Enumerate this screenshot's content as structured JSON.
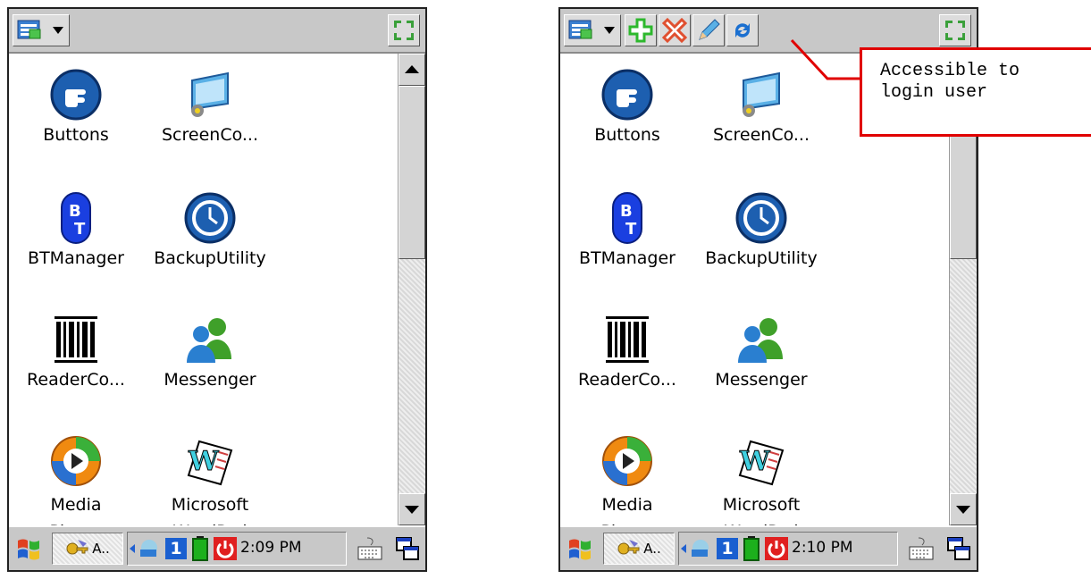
{
  "apps": [
    {
      "label": "Buttons",
      "icon": "pointing-hand-icon"
    },
    {
      "label": "ScreenCo...",
      "icon": "monitor-icon"
    },
    {
      "label": "BTManager",
      "icon": "bluetooth-icon"
    },
    {
      "label": "BackupUtility",
      "icon": "clock-backup-icon"
    },
    {
      "label": "ReaderCo...",
      "icon": "barcode-icon"
    },
    {
      "label": "Messenger",
      "icon": "users-icon"
    },
    {
      "label": "Media Player",
      "icon": "media-play-icon"
    },
    {
      "label": "Microsoft WordPad",
      "icon": "wordpad-icon"
    }
  ],
  "left": {
    "clock": "2:09 PM",
    "task_label": "A..",
    "tray_number": "1"
  },
  "right": {
    "clock": "2:10 PM",
    "task_label": "A..",
    "tray_number": "1"
  },
  "callout": {
    "text": "Accessible to login user",
    "color": "#e00000"
  },
  "colors": {
    "add": "#2db82d",
    "delete": "#e05030",
    "power": "#e02020",
    "battery": "#1cb01c"
  }
}
